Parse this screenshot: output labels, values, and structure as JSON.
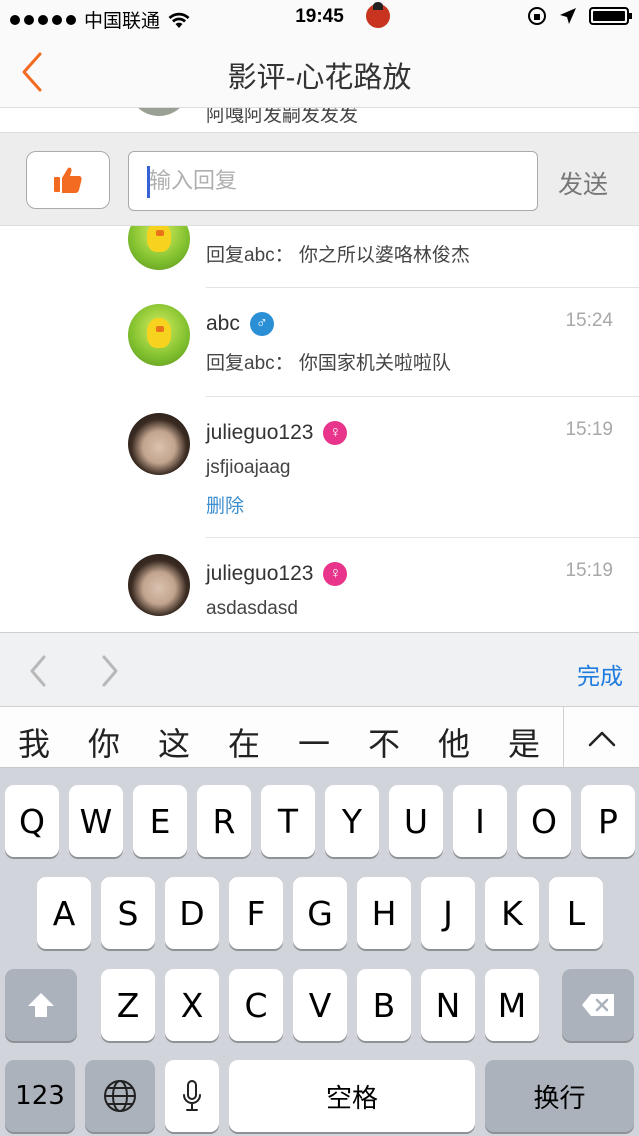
{
  "status_bar": {
    "carrier": "中国联通",
    "time": "19:45"
  },
  "nav": {
    "title": "影评-心花路放"
  },
  "partial_top": {
    "text": "阿嘎阿发嗣发发发"
  },
  "reply_bar": {
    "placeholder": "输入回复",
    "send_label": "发送"
  },
  "comments": [
    {
      "name": "",
      "gender": "male",
      "time": "",
      "content": "回复abc：  你之所以婆咯林俊杰",
      "delete": ""
    },
    {
      "name": "abc",
      "gender": "male",
      "gender_symbol": "♂",
      "time": "15:24",
      "content": "回复abc：  你国家机关啦啦队",
      "delete": ""
    },
    {
      "name": "julieguo123",
      "gender": "female",
      "gender_symbol": "♀",
      "time": "15:19",
      "content": "jsfjioajaag",
      "delete": "删除"
    },
    {
      "name": "julieguo123",
      "gender": "female",
      "gender_symbol": "♀",
      "time": "15:19",
      "content": "asdasdasd",
      "delete": ""
    }
  ],
  "accessory": {
    "done_label": "完成"
  },
  "candidates": [
    "我",
    "你",
    "这",
    "在",
    "一",
    "不",
    "他",
    "是"
  ],
  "keyboard": {
    "row1": [
      "Q",
      "W",
      "E",
      "R",
      "T",
      "Y",
      "U",
      "I",
      "O",
      "P"
    ],
    "row2": [
      "A",
      "S",
      "D",
      "F",
      "G",
      "H",
      "J",
      "K",
      "L"
    ],
    "row3": [
      "Z",
      "X",
      "C",
      "V",
      "B",
      "N",
      "M"
    ],
    "numbers_label": "123",
    "space_label": "空格",
    "return_label": "换行"
  }
}
